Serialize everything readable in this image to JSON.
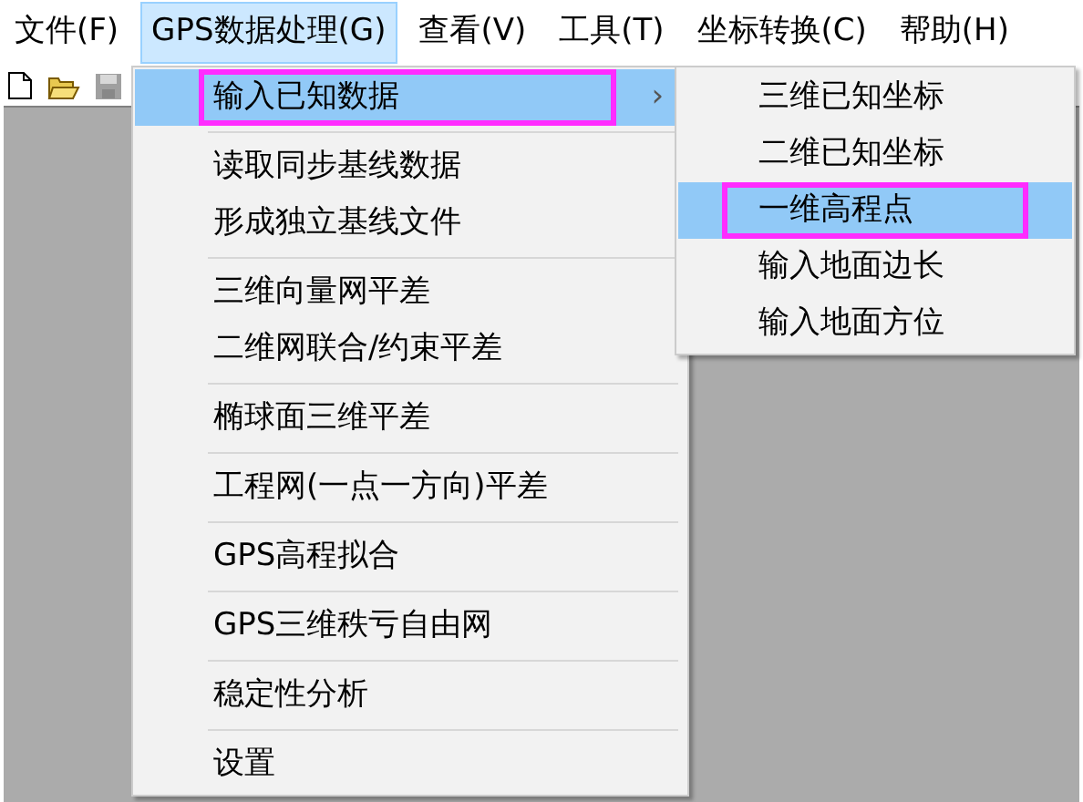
{
  "menubar": [
    {
      "label": "文件(F)",
      "selected": false
    },
    {
      "label": "GPS数据处理(G)",
      "selected": true
    },
    {
      "label": "查看(V)",
      "selected": false
    },
    {
      "label": "工具(T)",
      "selected": false
    },
    {
      "label": "坐标转换(C)",
      "selected": false
    },
    {
      "label": "帮助(H)",
      "selected": false
    }
  ],
  "toolbar": [
    {
      "kind": "new",
      "disabled": false
    },
    {
      "kind": "open",
      "disabled": false
    },
    {
      "kind": "save",
      "disabled": true
    }
  ],
  "dropdown": {
    "items": [
      {
        "label": "输入已知数据",
        "selected": true,
        "submenu": true,
        "annotated": true,
        "separator_before": false
      },
      {
        "label": "读取同步基线数据",
        "selected": false,
        "submenu": false,
        "annotated": false,
        "separator_before": true
      },
      {
        "label": "形成独立基线文件",
        "selected": false,
        "submenu": false,
        "annotated": false,
        "separator_before": false
      },
      {
        "label": "三维向量网平差",
        "selected": false,
        "submenu": false,
        "annotated": false,
        "separator_before": true
      },
      {
        "label": "二维网联合/约束平差",
        "selected": false,
        "submenu": false,
        "annotated": false,
        "separator_before": false
      },
      {
        "label": "椭球面三维平差",
        "selected": false,
        "submenu": false,
        "annotated": false,
        "separator_before": true
      },
      {
        "label": "工程网(一点一方向)平差",
        "selected": false,
        "submenu": false,
        "annotated": false,
        "separator_before": true
      },
      {
        "label": "GPS高程拟合",
        "selected": false,
        "submenu": false,
        "annotated": false,
        "separator_before": true
      },
      {
        "label": "GPS三维秩亏自由网",
        "selected": false,
        "submenu": false,
        "annotated": false,
        "separator_before": true
      },
      {
        "label": "稳定性分析",
        "selected": false,
        "submenu": false,
        "annotated": false,
        "separator_before": true
      },
      {
        "label": "设置",
        "selected": false,
        "submenu": false,
        "annotated": false,
        "separator_before": true
      }
    ],
    "submenu_arrow": "›"
  },
  "submenu": {
    "items": [
      {
        "label": "三维已知坐标",
        "selected": false,
        "annotated": false
      },
      {
        "label": "二维已知坐标",
        "selected": false,
        "annotated": false
      },
      {
        "label": "一维高程点",
        "selected": true,
        "annotated": true
      },
      {
        "label": "输入地面边长",
        "selected": false,
        "annotated": false
      },
      {
        "label": "输入地面方位",
        "selected": false,
        "annotated": false
      }
    ]
  }
}
